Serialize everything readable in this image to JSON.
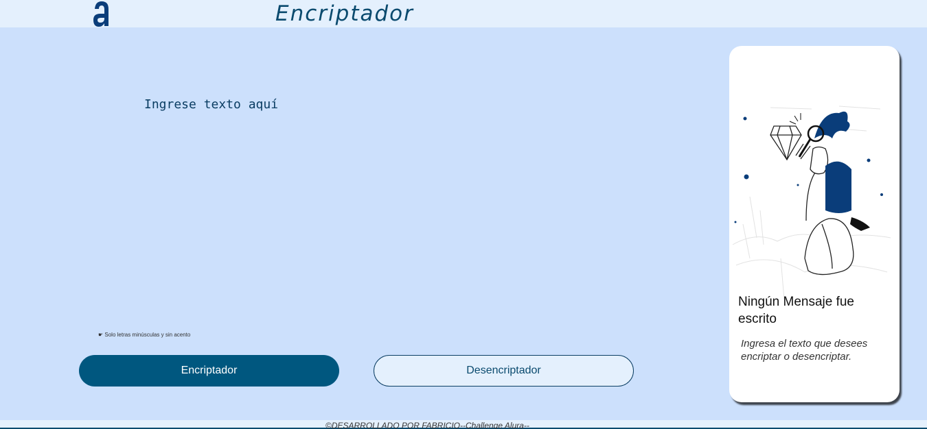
{
  "header": {
    "title": "Encriptador"
  },
  "input": {
    "placeholder": "Ingrese texto aquí"
  },
  "hint": "☛ Solo letras minúsculas y sin acento",
  "buttons": {
    "encrypt": "Encriptador",
    "decrypt": "Desencriptador"
  },
  "output_card": {
    "title": "Ningún Mensaje fue escrito",
    "subtitle": "Ingresa el texto que desees encriptar o desencriptar."
  },
  "footer": {
    "text": "©DESARROLLADO POR FABRICIO--Challenge Alura--"
  },
  "colors": {
    "accent": "#00577f",
    "background": "#cce0fc",
    "header": "#e4f0fd",
    "figure": "#0a3d7a"
  },
  "icons": {
    "logo": "alura-logo-icon",
    "illustration": "man-with-magnifier-illustration"
  }
}
